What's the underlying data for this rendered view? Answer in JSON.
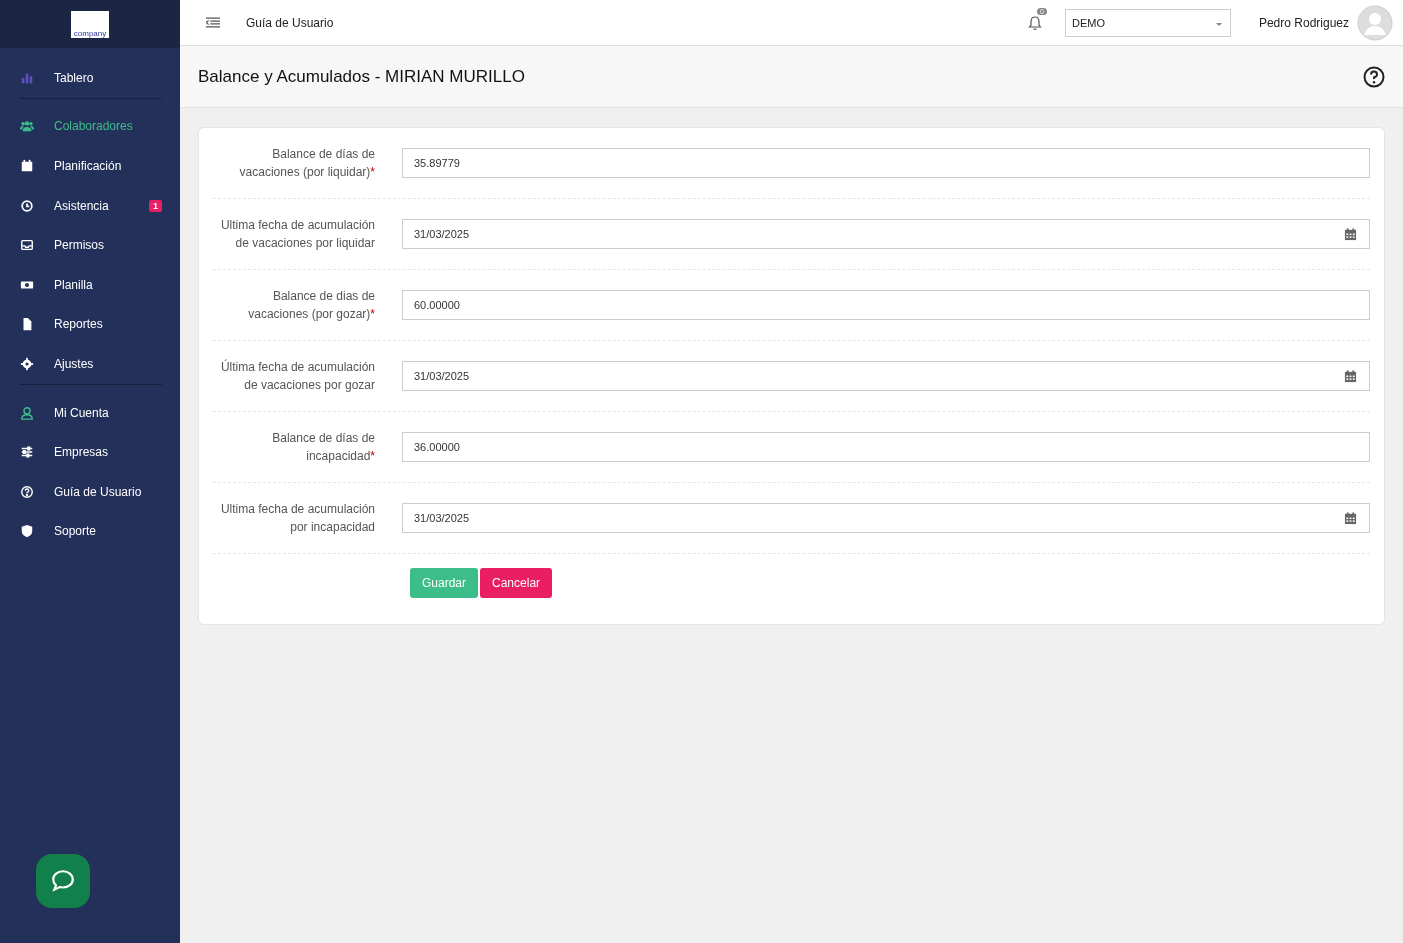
{
  "sidebar": {
    "logo_text": "company",
    "items": [
      {
        "label": "Tablero",
        "selected": false,
        "divider_after": true
      },
      {
        "label": "Colaboradores",
        "selected": true,
        "divider_after": false
      },
      {
        "label": "Planificación",
        "selected": false,
        "divider_after": false
      },
      {
        "label": "Asistencia",
        "selected": false,
        "divider_after": false,
        "badge": "1"
      },
      {
        "label": "Permisos",
        "selected": false,
        "divider_after": false
      },
      {
        "label": "Planilla",
        "selected": false,
        "divider_after": false
      },
      {
        "label": "Reportes",
        "selected": false,
        "divider_after": false
      },
      {
        "label": "Ajustes",
        "selected": false,
        "divider_after": true
      },
      {
        "label": "Mi Cuenta",
        "selected": false,
        "divider_after": false
      },
      {
        "label": "Empresas",
        "selected": false,
        "divider_after": false
      },
      {
        "label": "Guía de Usuario",
        "selected": false,
        "divider_after": false
      },
      {
        "label": "Soporte",
        "selected": false,
        "divider_after": false
      }
    ]
  },
  "topbar": {
    "link": "Guía de Usuario",
    "notification_count": "0",
    "company_select": "DEMO",
    "user_name": "Pedro Rodriguez"
  },
  "page_title": "Balance y Acumulados - MIRIAN MURILLO",
  "form": {
    "fields": [
      {
        "label": "Balance de días de vacaciones (por liquidar)",
        "required_mark": "*",
        "kind": "text",
        "value": "35.89779"
      },
      {
        "label": "Ultima fecha de acumulación de vacaciones por liquidar",
        "kind": "date",
        "value": "31/03/2025"
      },
      {
        "label": "Balance de dias de vacaciones (por gozar)",
        "required_mark": "*",
        "kind": "text",
        "value": "60.00000"
      },
      {
        "label": "Última fecha de acumulación de vacaciones por gozar",
        "kind": "date",
        "value": "31/03/2025"
      },
      {
        "label": "Balance de días de incapacidad",
        "required_mark": "*",
        "kind": "text",
        "value": "36.00000"
      },
      {
        "label": "Ultima fecha de acumulación por incapacidad",
        "kind": "date",
        "value": "31/03/2025"
      }
    ],
    "buttons": [
      {
        "label": "Guardar",
        "kind": "primary"
      },
      {
        "label": "Cancelar",
        "kind": "danger"
      }
    ]
  }
}
